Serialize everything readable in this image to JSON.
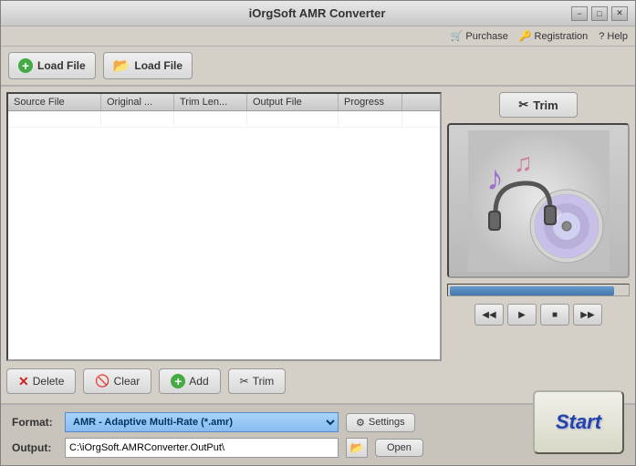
{
  "window": {
    "title": "iOrgSoft AMR Converter"
  },
  "titlebar": {
    "minimize_label": "−",
    "maximize_label": "□",
    "close_label": "✕"
  },
  "menu": {
    "items": [
      {
        "id": "purchase",
        "label": "Purchase",
        "icon": "cart-icon"
      },
      {
        "id": "registration",
        "label": "Registration",
        "icon": "key-icon"
      },
      {
        "id": "help",
        "label": "Help",
        "icon": "question-icon"
      }
    ]
  },
  "toolbar": {
    "load_file_1_label": "Load File",
    "load_file_2_label": "Load File"
  },
  "table": {
    "columns": [
      "Source File",
      "Original ...",
      "Trim Len...",
      "Output File",
      "Progress"
    ],
    "widths": [
      "100",
      "80",
      "80",
      "100",
      "70"
    ]
  },
  "bottom_buttons": {
    "delete_label": "Delete",
    "clear_label": "Clear",
    "add_label": "Add",
    "trim_label": "Trim"
  },
  "right_panel": {
    "trim_label": "Trim"
  },
  "player_controls": {
    "rewind": "◀◀",
    "play": "▶",
    "stop": "■",
    "forward": "▶▶"
  },
  "format_panel": {
    "format_label": "Format:",
    "format_value": "AMR - Adaptive Multi-Rate (*.amr)",
    "settings_label": "Settings",
    "output_label": "Output:",
    "output_path": "C:\\iOrgSoft.AMRConverter.OutPut\\",
    "browse_icon": "📁",
    "open_label": "Open",
    "start_label": "Start"
  }
}
